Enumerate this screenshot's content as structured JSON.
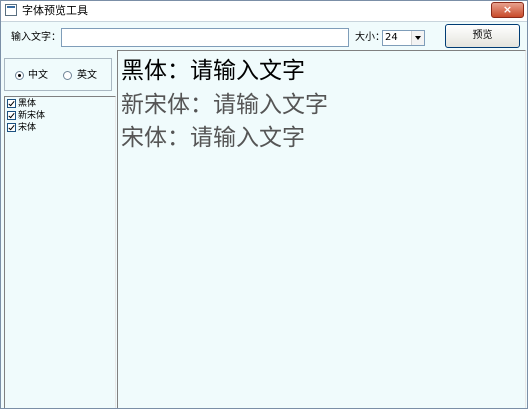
{
  "window": {
    "title": "字体预览工具",
    "close_glyph": "×"
  },
  "toolbar": {
    "input_label": "输入文字：",
    "input_value": "",
    "size_label": "大小：",
    "size_value": "24",
    "preview_label": "预览"
  },
  "language": {
    "chinese_label": "中文",
    "english_label": "英文",
    "selected": "中文"
  },
  "font_list": [
    {
      "name": "黑体",
      "checked": true
    },
    {
      "name": "新宋体",
      "checked": true
    },
    {
      "name": "宋体",
      "checked": true
    }
  ],
  "preview_lines": [
    {
      "text": "黑体：请输入文字",
      "color": "#000000"
    },
    {
      "text": "新宋体：请输入文字",
      "color": "#555555"
    },
    {
      "text": "宋体：请输入文字",
      "color": "#555555"
    }
  ]
}
